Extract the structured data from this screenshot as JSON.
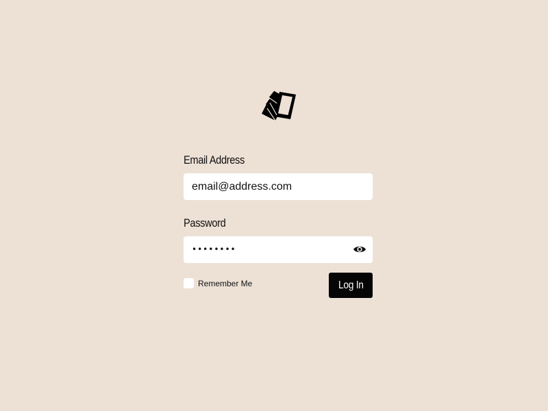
{
  "logo": {
    "icon": "stacked-cards-logo-icon"
  },
  "form": {
    "email": {
      "label": "Email Address",
      "value": "email@address.com",
      "placeholder": "email@address.com"
    },
    "password": {
      "label": "Password",
      "masked_value": "••••••••",
      "toggle_icon": "eye-icon"
    },
    "remember": {
      "label": "Remember Me",
      "checked": false
    },
    "submit_label": "Log In"
  },
  "colors": {
    "background": "#ede1d6",
    "field_background": "#ffffff",
    "button_background": "#050505",
    "button_text": "#ffffff",
    "text": "#111111"
  }
}
